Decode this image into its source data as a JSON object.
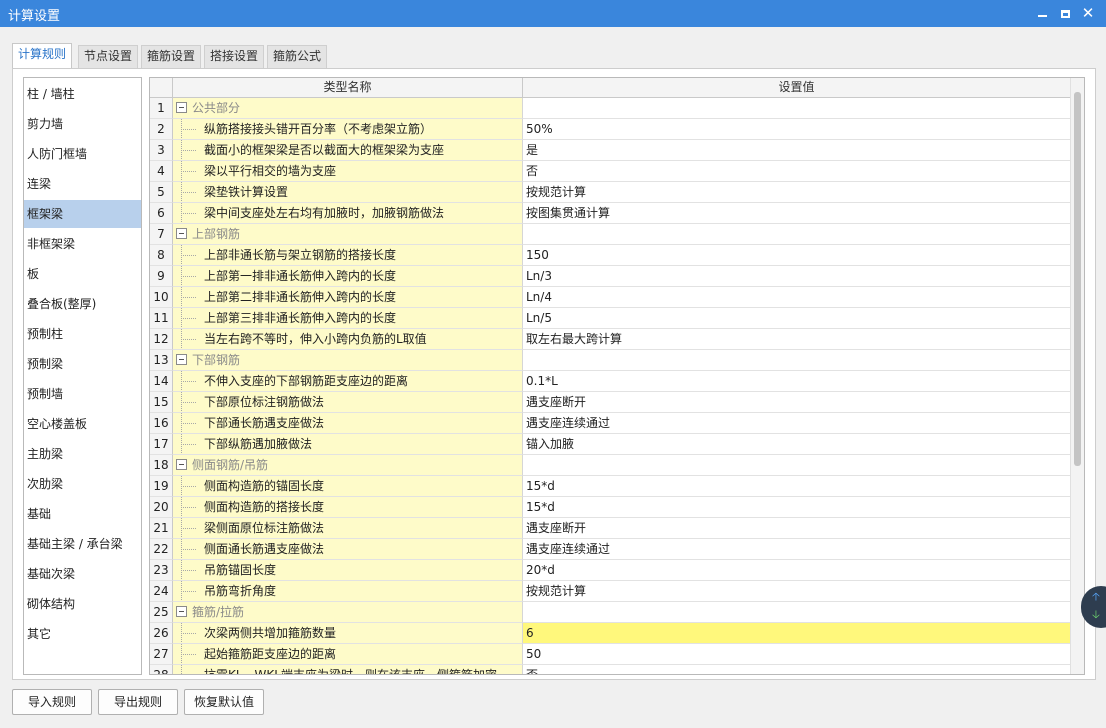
{
  "window": {
    "title": "计算设置"
  },
  "tabs": [
    {
      "label": "计算规则",
      "active": true
    },
    {
      "label": "节点设置",
      "active": false
    },
    {
      "label": "箍筋设置",
      "active": false
    },
    {
      "label": "搭接设置",
      "active": false
    },
    {
      "label": "箍筋公式",
      "active": false
    }
  ],
  "sidebar": {
    "selected": "框架梁",
    "items": [
      "柱 / 墙柱",
      "剪力墙",
      "人防门框墙",
      "连梁",
      "框架梁",
      "非框架梁",
      "板",
      "叠合板(整厚)",
      "预制柱",
      "预制梁",
      "预制墙",
      "空心楼盖板",
      "主肋梁",
      "次肋梁",
      "基础",
      "基础主梁 / 承台梁",
      "基础次梁",
      "砌体结构",
      "其它"
    ]
  },
  "grid": {
    "headers": {
      "name": "类型名称",
      "value": "设置值"
    },
    "rows": [
      {
        "num": "1",
        "type": "group",
        "name": "公共部分",
        "value": ""
      },
      {
        "num": "2",
        "type": "item",
        "name": "纵筋搭接接头错开百分率（不考虑架立筋）",
        "value": "50%"
      },
      {
        "num": "3",
        "type": "item",
        "name": "截面小的框架梁是否以截面大的框架梁为支座",
        "value": "是"
      },
      {
        "num": "4",
        "type": "item",
        "name": "梁以平行相交的墙为支座",
        "value": "否"
      },
      {
        "num": "5",
        "type": "item",
        "name": "梁垫铁计算设置",
        "value": "按规范计算"
      },
      {
        "num": "6",
        "type": "item",
        "name": "梁中间支座处左右均有加腋时，加腋钢筋做法",
        "value": "按图集贯通计算"
      },
      {
        "num": "7",
        "type": "group",
        "name": "上部钢筋",
        "value": ""
      },
      {
        "num": "8",
        "type": "item",
        "name": "上部非通长筋与架立钢筋的搭接长度",
        "value": "150"
      },
      {
        "num": "9",
        "type": "item",
        "name": "上部第一排非通长筋伸入跨内的长度",
        "value": "Ln/3"
      },
      {
        "num": "10",
        "type": "item",
        "name": "上部第二排非通长筋伸入跨内的长度",
        "value": "Ln/4"
      },
      {
        "num": "11",
        "type": "item",
        "name": "上部第三排非通长筋伸入跨内的长度",
        "value": "Ln/5"
      },
      {
        "num": "12",
        "type": "item",
        "name": "当左右跨不等时，伸入小跨内负筋的L取值",
        "value": "取左右最大跨计算"
      },
      {
        "num": "13",
        "type": "group",
        "name": "下部钢筋",
        "value": ""
      },
      {
        "num": "14",
        "type": "item",
        "name": "不伸入支座的下部钢筋距支座边的距离",
        "value": "0.1*L"
      },
      {
        "num": "15",
        "type": "item",
        "name": "下部原位标注钢筋做法",
        "value": "遇支座断开"
      },
      {
        "num": "16",
        "type": "item",
        "name": "下部通长筋遇支座做法",
        "value": "遇支座连续通过"
      },
      {
        "num": "17",
        "type": "item",
        "name": "下部纵筋遇加腋做法",
        "value": "锚入加腋"
      },
      {
        "num": "18",
        "type": "group",
        "name": "侧面钢筋/吊筋",
        "value": ""
      },
      {
        "num": "19",
        "type": "item",
        "name": "侧面构造筋的锚固长度",
        "value": "15*d"
      },
      {
        "num": "20",
        "type": "item",
        "name": "侧面构造筋的搭接长度",
        "value": "15*d"
      },
      {
        "num": "21",
        "type": "item",
        "name": "梁侧面原位标注筋做法",
        "value": "遇支座断开"
      },
      {
        "num": "22",
        "type": "item",
        "name": "侧面通长筋遇支座做法",
        "value": "遇支座连续通过"
      },
      {
        "num": "23",
        "type": "item",
        "name": "吊筋锚固长度",
        "value": "20*d"
      },
      {
        "num": "24",
        "type": "item",
        "name": "吊筋弯折角度",
        "value": "按规范计算"
      },
      {
        "num": "25",
        "type": "group",
        "name": "箍筋/拉筋",
        "value": ""
      },
      {
        "num": "26",
        "type": "item",
        "name": "次梁两侧共增加箍筋数量",
        "value": "6",
        "highlight": true
      },
      {
        "num": "27",
        "type": "item",
        "name": "起始箍筋距支座边的距离",
        "value": "50"
      },
      {
        "num": "28",
        "type": "item",
        "name": "抗震KL、WKL端支座为梁时，则在该支座一侧箍筋加密",
        "value": "否"
      }
    ]
  },
  "buttons": {
    "import": "导入规则",
    "export": "导出规则",
    "restore": "恢复默认值"
  },
  "icons": {
    "minimize": "minimize-icon",
    "maximize": "maximize-icon",
    "close": "close-icon",
    "scroll_up": "arrow-up-icon",
    "scroll_down": "arrow-down-icon"
  },
  "colors": {
    "titlebar": "#3a86dc",
    "active_tab_text": "#2a74c9",
    "name_cell_bg": "#fefbc9",
    "highlight_value_bg": "#fff87c",
    "sidebar_selected_bg": "#b8d0ec"
  }
}
